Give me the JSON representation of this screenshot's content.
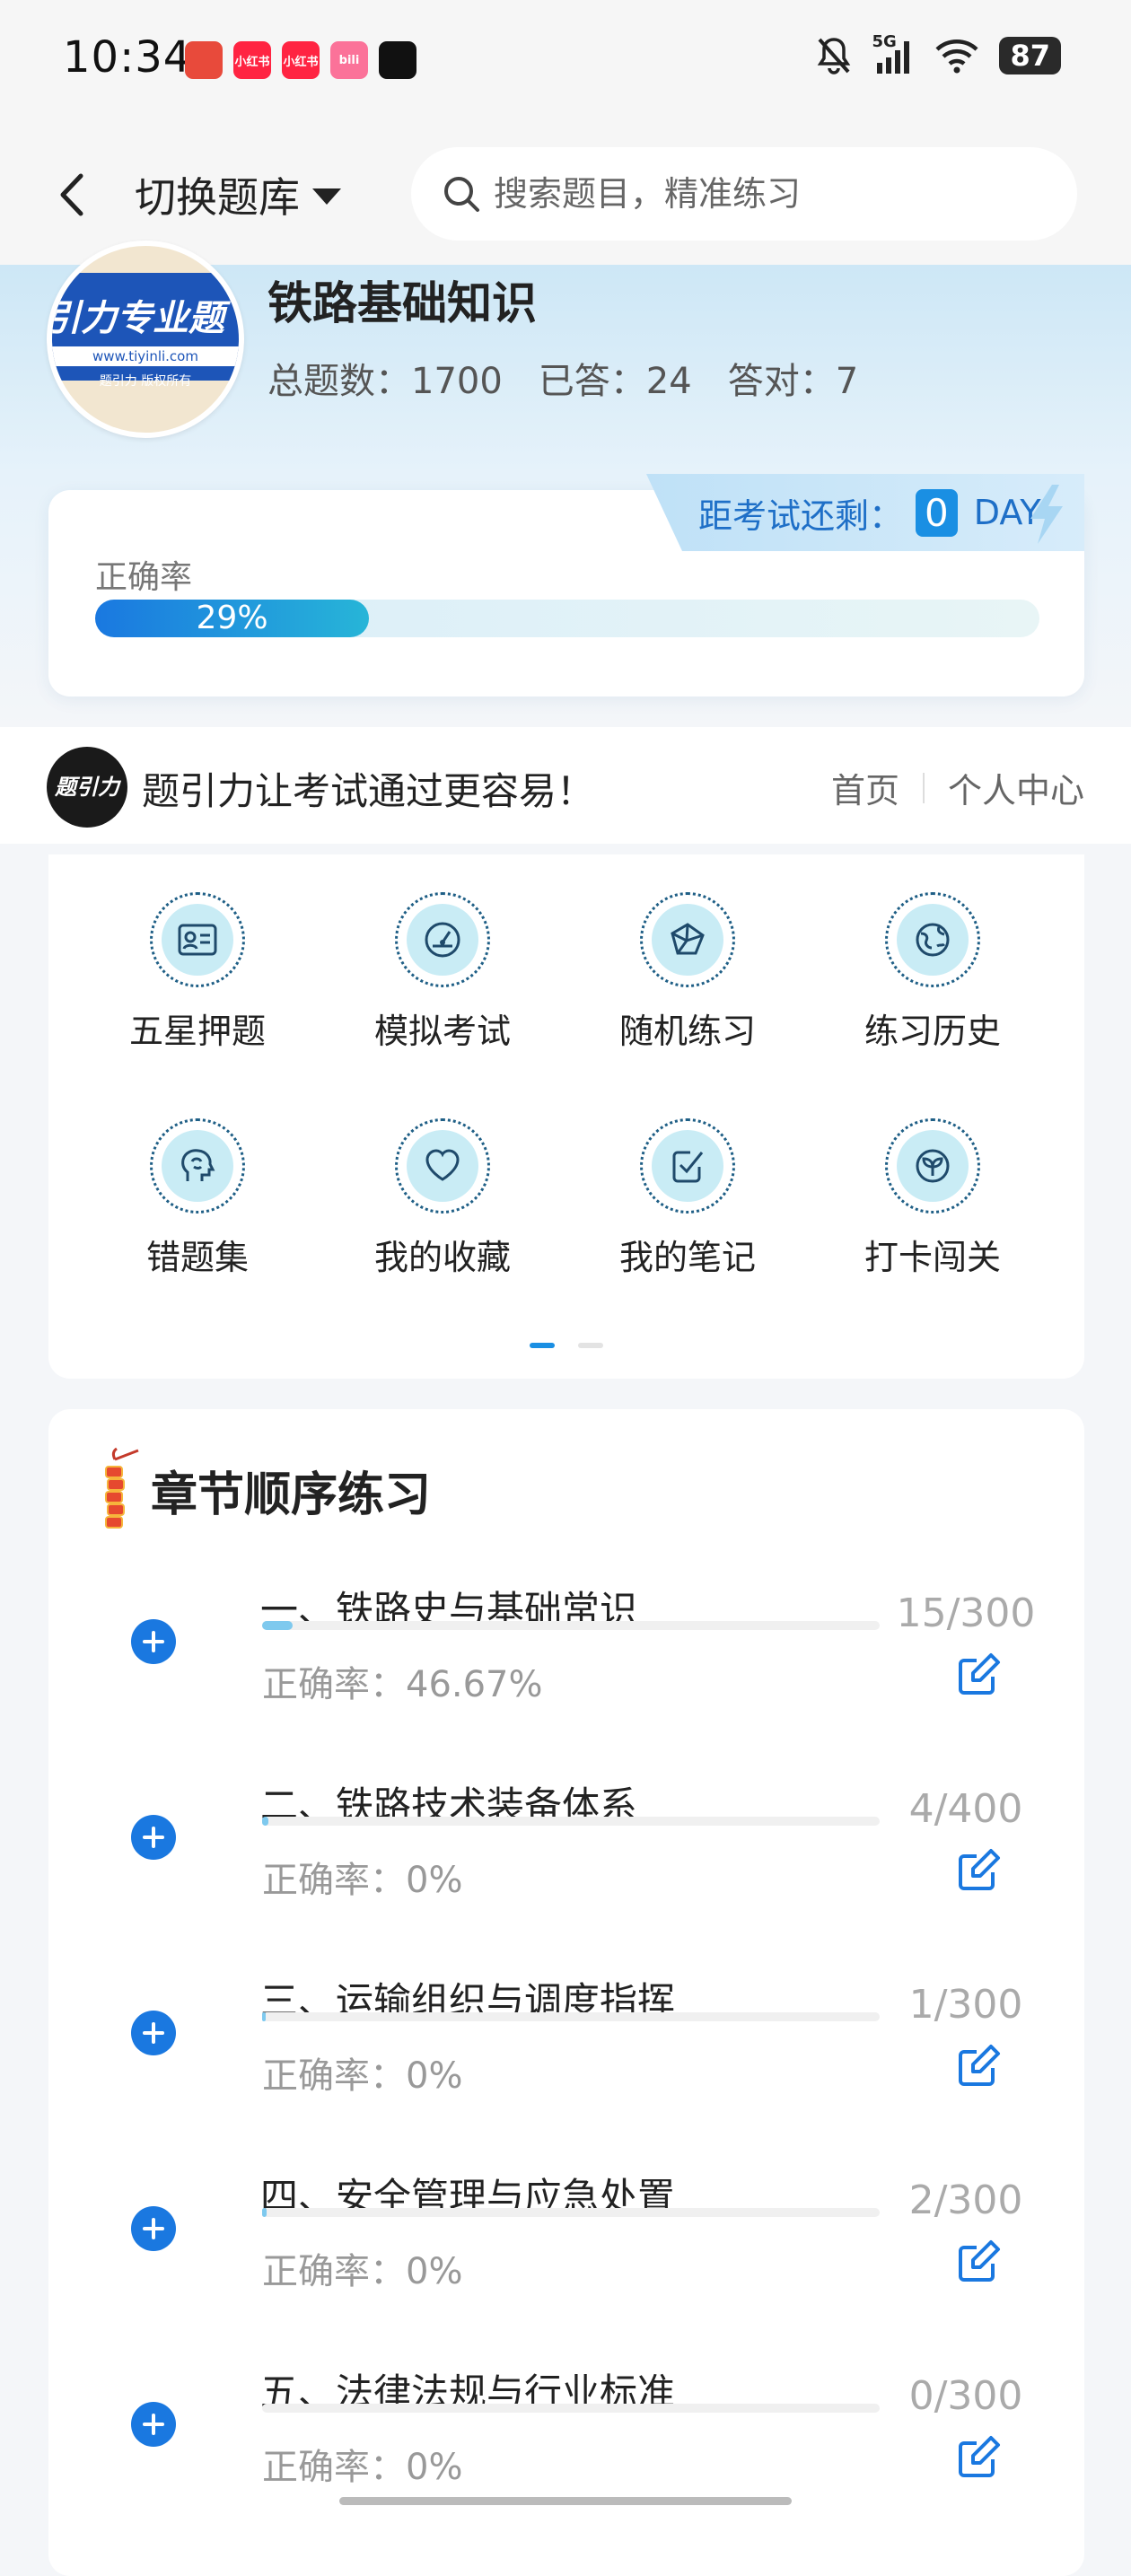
{
  "status_bar": {
    "time": "10:34",
    "app_badges": [
      {
        "icon": "red-app-icon",
        "color": "#e84a3b",
        "text": ""
      },
      {
        "icon": "xiaohongshu-icon",
        "color": "#ff2442",
        "text": "小红书"
      },
      {
        "icon": "xiaohongshu-icon",
        "color": "#ff2442",
        "text": "小红书"
      },
      {
        "icon": "bilibili-icon",
        "color": "#fb7299",
        "text": "bili"
      },
      {
        "icon": "capcut-icon",
        "color": "#111111",
        "text": ""
      }
    ],
    "network": "5G",
    "battery": "87"
  },
  "nav": {
    "switch_label": "切换题库",
    "search_placeholder": "搜索题目，精准练习"
  },
  "bank": {
    "logo_big": "引力专业题",
    "logo_url": "www.tiyinli.com",
    "logo_copy": "题引力 版权所有",
    "title": "铁路基础知识",
    "total": "总题数：1700",
    "answered": "已答：24",
    "correct": "答对：7"
  },
  "exam": {
    "label": "距考试还剩：",
    "days": "0",
    "unit": "DAY"
  },
  "accuracy": {
    "label": "正确率",
    "percent_text": "29%",
    "value": 0.29
  },
  "brand": {
    "logo_text": "题引力",
    "slogan": "题引力让考试通过更容易！",
    "home": "首页",
    "profile": "个人中心"
  },
  "grid": [
    {
      "label": "五星押题",
      "icon": "id-card-icon"
    },
    {
      "label": "模拟考试",
      "icon": "speedometer-icon"
    },
    {
      "label": "随机练习",
      "icon": "network-icon"
    },
    {
      "label": "练习历史",
      "icon": "globe-icon"
    },
    {
      "label": "错题集",
      "icon": "brain-head-icon"
    },
    {
      "label": "我的收藏",
      "icon": "heart-icon"
    },
    {
      "label": "我的笔记",
      "icon": "check-note-icon"
    },
    {
      "label": "打卡闯关",
      "icon": "sprout-icon"
    }
  ],
  "chapters": {
    "title": "章节顺序练习",
    "items": [
      {
        "name": "一、铁路史与基础常识",
        "accuracy": "正确率：46.67%",
        "count": "15/300",
        "progress": 0.05
      },
      {
        "name": "二、铁路技术装备体系",
        "accuracy": "正确率：0%",
        "count": "4/400",
        "progress": 0.01
      },
      {
        "name": "三、运输组织与调度指挥",
        "accuracy": "正确率：0%",
        "count": "1/300",
        "progress": 0.0033
      },
      {
        "name": "四、安全管理与应急处置",
        "accuracy": "正确率：0%",
        "count": "2/300",
        "progress": 0.0067
      },
      {
        "name": "五、法律法规与行业标准",
        "accuracy": "正确率：0%",
        "count": "0/300",
        "progress": 0
      }
    ]
  }
}
